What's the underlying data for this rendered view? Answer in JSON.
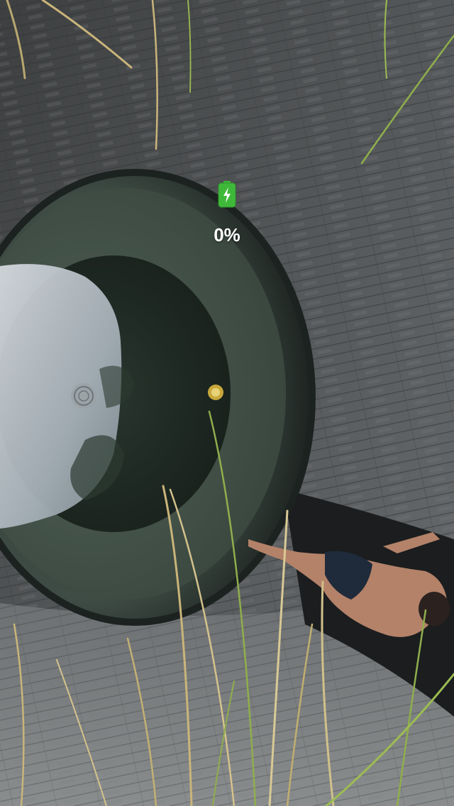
{
  "battery": {
    "percent_label": "0%",
    "icon": "battery-charging-icon",
    "color": "#3fb83a",
    "level": 0
  }
}
